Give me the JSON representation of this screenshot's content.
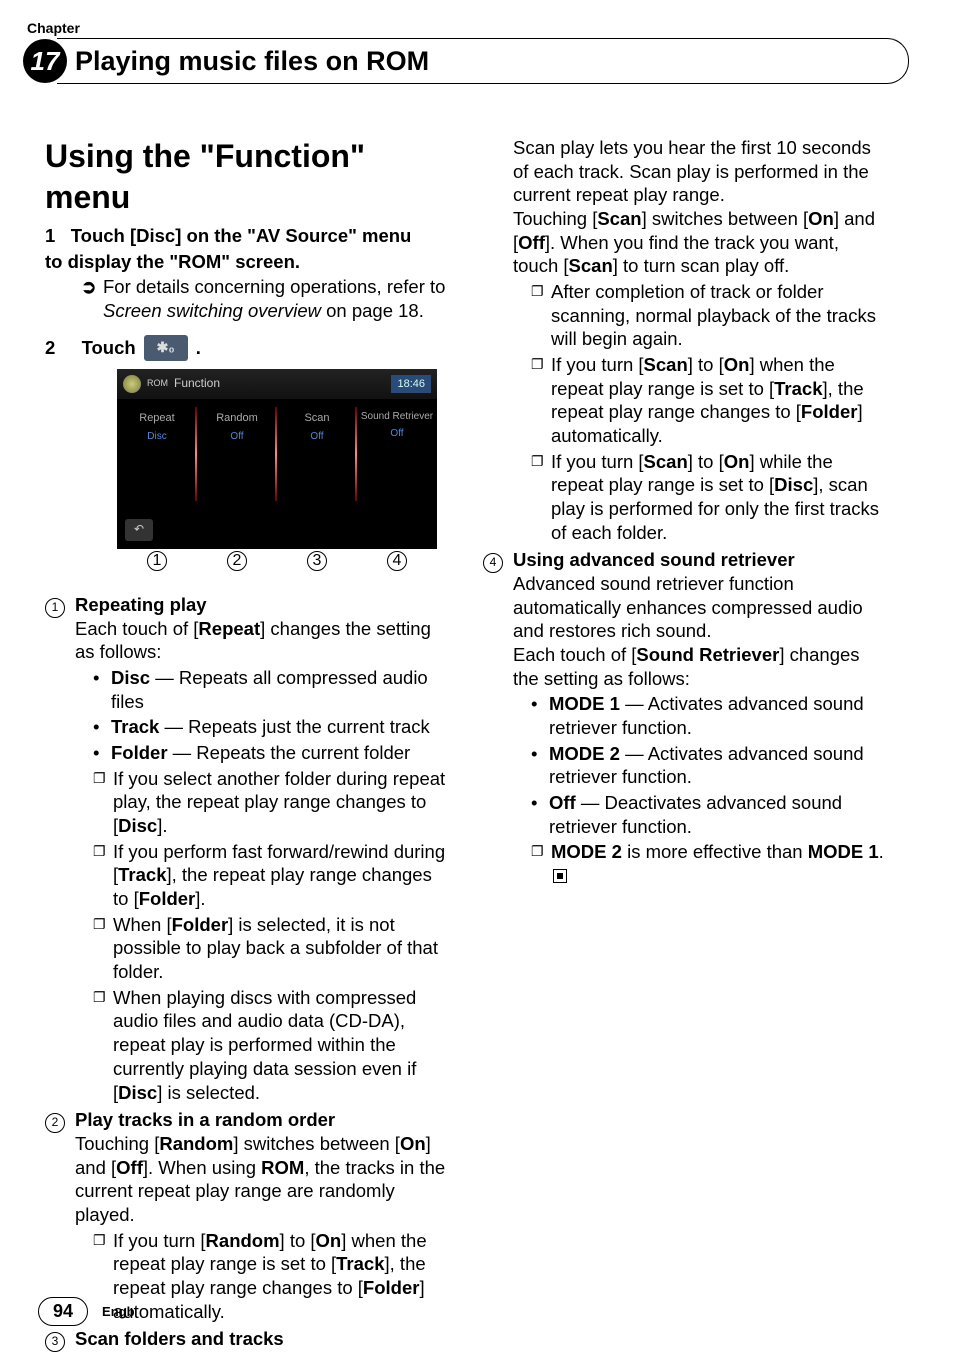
{
  "header": {
    "chapter_label": "Chapter",
    "chapter_number": "17",
    "chapter_title": "Playing music files on ROM"
  },
  "col1": {
    "h2_pre": "Using the \"",
    "h2_func": "Function",
    "h2_post": "\" menu",
    "step1_num": "1",
    "step1_a": "Touch [Disc] on the \"AV Source\" menu",
    "step1_b": "to display the \"ROM\" screen.",
    "step1_detail_a": "For details concerning operations, refer to",
    "step1_detail_b": "Screen switching overview",
    "step1_detail_c": " on page 18.",
    "step2_num": "2",
    "step2_a": "Touch ",
    "step2_b": ".",
    "screenshot": {
      "top_label": "Function",
      "clock": "18:46",
      "cells": [
        {
          "lbl": "Repeat",
          "val": "Disc"
        },
        {
          "lbl": "Random",
          "val": "Off"
        },
        {
          "lbl": "Scan",
          "val": "Off"
        },
        {
          "lbl": "Sound Retriever",
          "val": "Off"
        }
      ],
      "callouts": [
        "1",
        "2",
        "3",
        "4"
      ]
    },
    "item1": {
      "num": "1",
      "title": "Repeating play",
      "intro_a": "Each touch of [",
      "intro_b": "Repeat",
      "intro_c": "] changes the setting as follows:",
      "b1": {
        "k": "Disc",
        "v": " — Repeats all compressed audio files"
      },
      "b2": {
        "k": "Track",
        "v": " — Repeats just the current track"
      },
      "b3": {
        "k": "Folder",
        "v": " — Repeats the current folder"
      },
      "n1_a": "If you select another folder during repeat play, the repeat play range changes to [",
      "n1_b": "Disc",
      "n1_c": "].",
      "n2_a": "If you perform fast forward/rewind during [",
      "n2_b": "Track",
      "n2_c": "], the repeat play range changes to [",
      "n2_d": "Folder",
      "n2_e": "].",
      "n3_a": "When [",
      "n3_b": "Folder",
      "n3_c": "] is selected, it is not possible to play back a subfolder of that folder.",
      "n4_a": "When playing discs with compressed audio files and audio data (CD-DA), repeat play is performed within the currently playing data session even if [",
      "n4_b": "Disc",
      "n4_c": "] is selected."
    },
    "item2": {
      "num": "2",
      "title": "Play tracks in a random order",
      "p_a": "Touching [",
      "p_b": "Random",
      "p_c": "] switches between [",
      "p_d": "On",
      "p_e": "] and [",
      "p_f": "Off",
      "p_g": "]. When using ",
      "p_h": "ROM",
      "p_i": ", the tracks in the current repeat play range are randomly played.",
      "n1_a": "If you turn [",
      "n1_b": "Random",
      "n1_c": "] to [",
      "n1_d": "On",
      "n1_e": "] when the repeat play range is set to [",
      "n1_f": "Track",
      "n1_g": "], the repeat play range changes to [",
      "n1_h": "Folder",
      "n1_i": "] automatically."
    },
    "item3": {
      "num": "3",
      "title": "Scan folders and tracks"
    }
  },
  "col2": {
    "scan_intro": "Scan play lets you hear the first 10 seconds of each track. Scan play is performed in the current repeat play range.",
    "scan_p_a": "Touching [",
    "scan_p_b": "Scan",
    "scan_p_c": "] switches between [",
    "scan_p_d": "On",
    "scan_p_e": "] and [",
    "scan_p_f": "Off",
    "scan_p_g": "]. When you find the track you want, touch [",
    "scan_p_h": "Scan",
    "scan_p_i": "] to turn scan play off.",
    "n1": "After completion of track or folder scanning, normal playback of the tracks will begin again.",
    "n2_a": "If you turn [",
    "n2_b": "Scan",
    "n2_c": "] to [",
    "n2_d": "On",
    "n2_e": "] when the repeat play range is set to [",
    "n2_f": "Track",
    "n2_g": "], the repeat play range changes to [",
    "n2_h": "Folder",
    "n2_i": "] automatically.",
    "n3_a": "If you turn [",
    "n3_b": "Scan",
    "n3_c": "] to [",
    "n3_d": "On",
    "n3_e": "] while the repeat play range is set to [",
    "n3_f": "Disc",
    "n3_g": "], scan play is performed for only the first tracks of each folder.",
    "item4": {
      "num": "4",
      "title": "Using advanced sound retriever",
      "p1": "Advanced sound retriever function automatically enhances compressed audio and restores rich sound.",
      "p2_a": "Each touch of [",
      "p2_b": "Sound Retriever",
      "p2_c": "] changes the setting as follows:",
      "b1": {
        "k": "MODE 1",
        "v": " — Activates advanced sound retriever function."
      },
      "b2": {
        "k": "MODE 2",
        "v": " — Activates advanced sound retriever function."
      },
      "b3": {
        "k": "Off",
        "v": " — Deactivates advanced sound retriever function."
      },
      "n1_a": "MODE 2",
      "n1_b": " is more effective than ",
      "n1_c": "MODE 1",
      "n1_d": "."
    }
  },
  "footer": {
    "page": "94",
    "lang": "Engb"
  }
}
